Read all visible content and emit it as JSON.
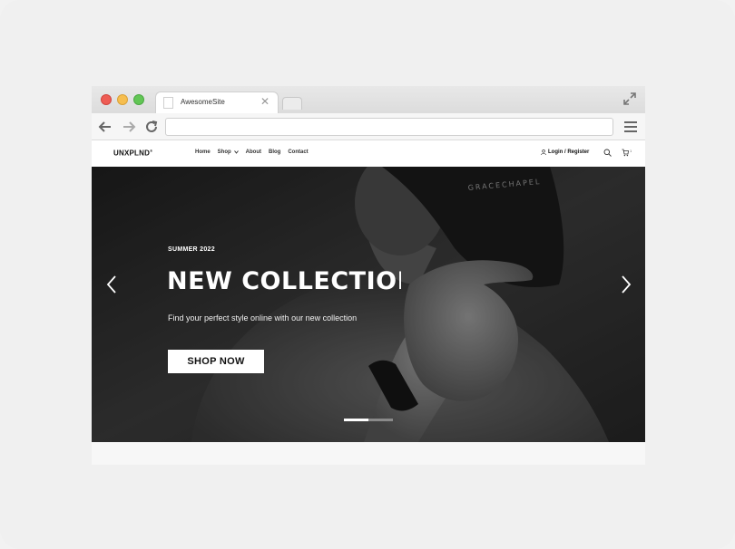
{
  "browser": {
    "tab_title": "AwesomeSite",
    "tab_close": "✕",
    "url": ""
  },
  "site": {
    "logo": "UNXPLND",
    "logo_mark": "®",
    "nav": [
      "Home",
      "Shop",
      "About",
      "Blog",
      "Contact"
    ],
    "login_label": "Login / Register",
    "cart_count": "1"
  },
  "hero": {
    "eyebrow": "SUMMER 2022",
    "title": "NEW COLLECTION",
    "subtitle": "Find your perfect style online with our new collection",
    "cta": "SHOP NOW",
    "cap_text": "GRACECHAPEL",
    "slides_total": 2,
    "active_slide": 1
  },
  "colors": {
    "hero_bg": "#2b2b2b",
    "accent": "#ffffff",
    "traffic_red": "#ee5c54",
    "traffic_yellow": "#f6be4f",
    "traffic_green": "#62c655"
  }
}
